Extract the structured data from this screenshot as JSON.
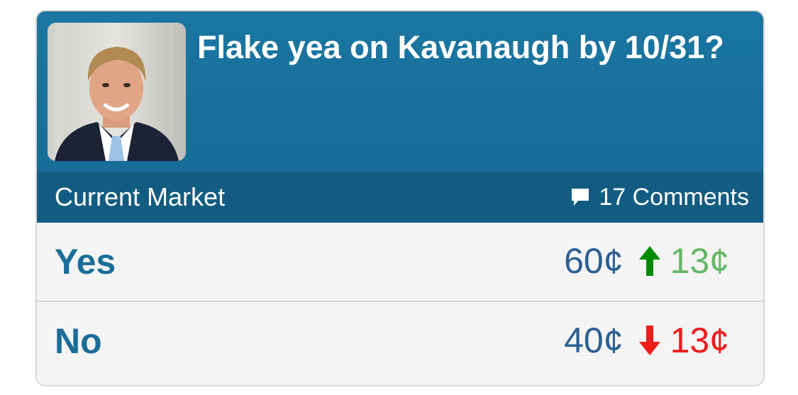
{
  "market": {
    "title": "Flake yea on Kavanaugh by 10/31?",
    "photo": "senator-portrait",
    "section_label": "Current Market",
    "comments_label": "17 Comments",
    "comments_icon": "speech-bubble-icon"
  },
  "outcomes": [
    {
      "label": "Yes",
      "price": "60¢",
      "direction": "up",
      "change": "13¢",
      "change_color": "#66b766",
      "arrow_color": "#008a00"
    },
    {
      "label": "No",
      "price": "40¢",
      "direction": "down",
      "change": "13¢",
      "change_color": "#ee1c1c",
      "arrow_color": "#ee1c1c"
    }
  ],
  "colors": {
    "header": "#1b76a2",
    "subbar": "#135c81",
    "outcome_text": "#1b6d99",
    "price_text": "#2b5f91"
  }
}
